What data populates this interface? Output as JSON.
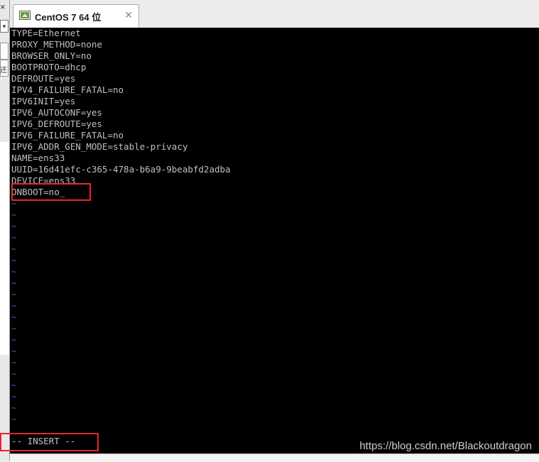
{
  "tab": {
    "title": "CentOS 7 64 位",
    "close_glyph": "✕",
    "icon": "vm-icon"
  },
  "left_panel": {
    "close_glyph": "×",
    "dropdown_glyph": "▾",
    "side_char": "还"
  },
  "terminal": {
    "lines": [
      "TYPE=Ethernet",
      "PROXY_METHOD=none",
      "BROWSER_ONLY=no",
      "BOOTPROTO=dhcp",
      "DEFROUTE=yes",
      "IPV4_FAILURE_FATAL=no",
      "IPV6INIT=yes",
      "IPV6_AUTOCONF=yes",
      "IPV6_DEFROUTE=yes",
      "IPV6_FAILURE_FATAL=no",
      "IPV6_ADDR_GEN_MODE=stable-privacy",
      "NAME=ens33",
      "UUID=16d41efc-c365-478a-b6a9-9beabfd2adba",
      "DEVICE=ens33",
      "ONBOOT=no_"
    ],
    "empty_line_marker": "~",
    "mode": "-- INSERT --"
  },
  "watermark": "https://blog.csdn.net/Blackoutdragon",
  "colors": {
    "terminal_bg": "#000000",
    "text": "#c0c0c0",
    "tilde": "#3b5bd6",
    "annotation": "#e8262b"
  }
}
